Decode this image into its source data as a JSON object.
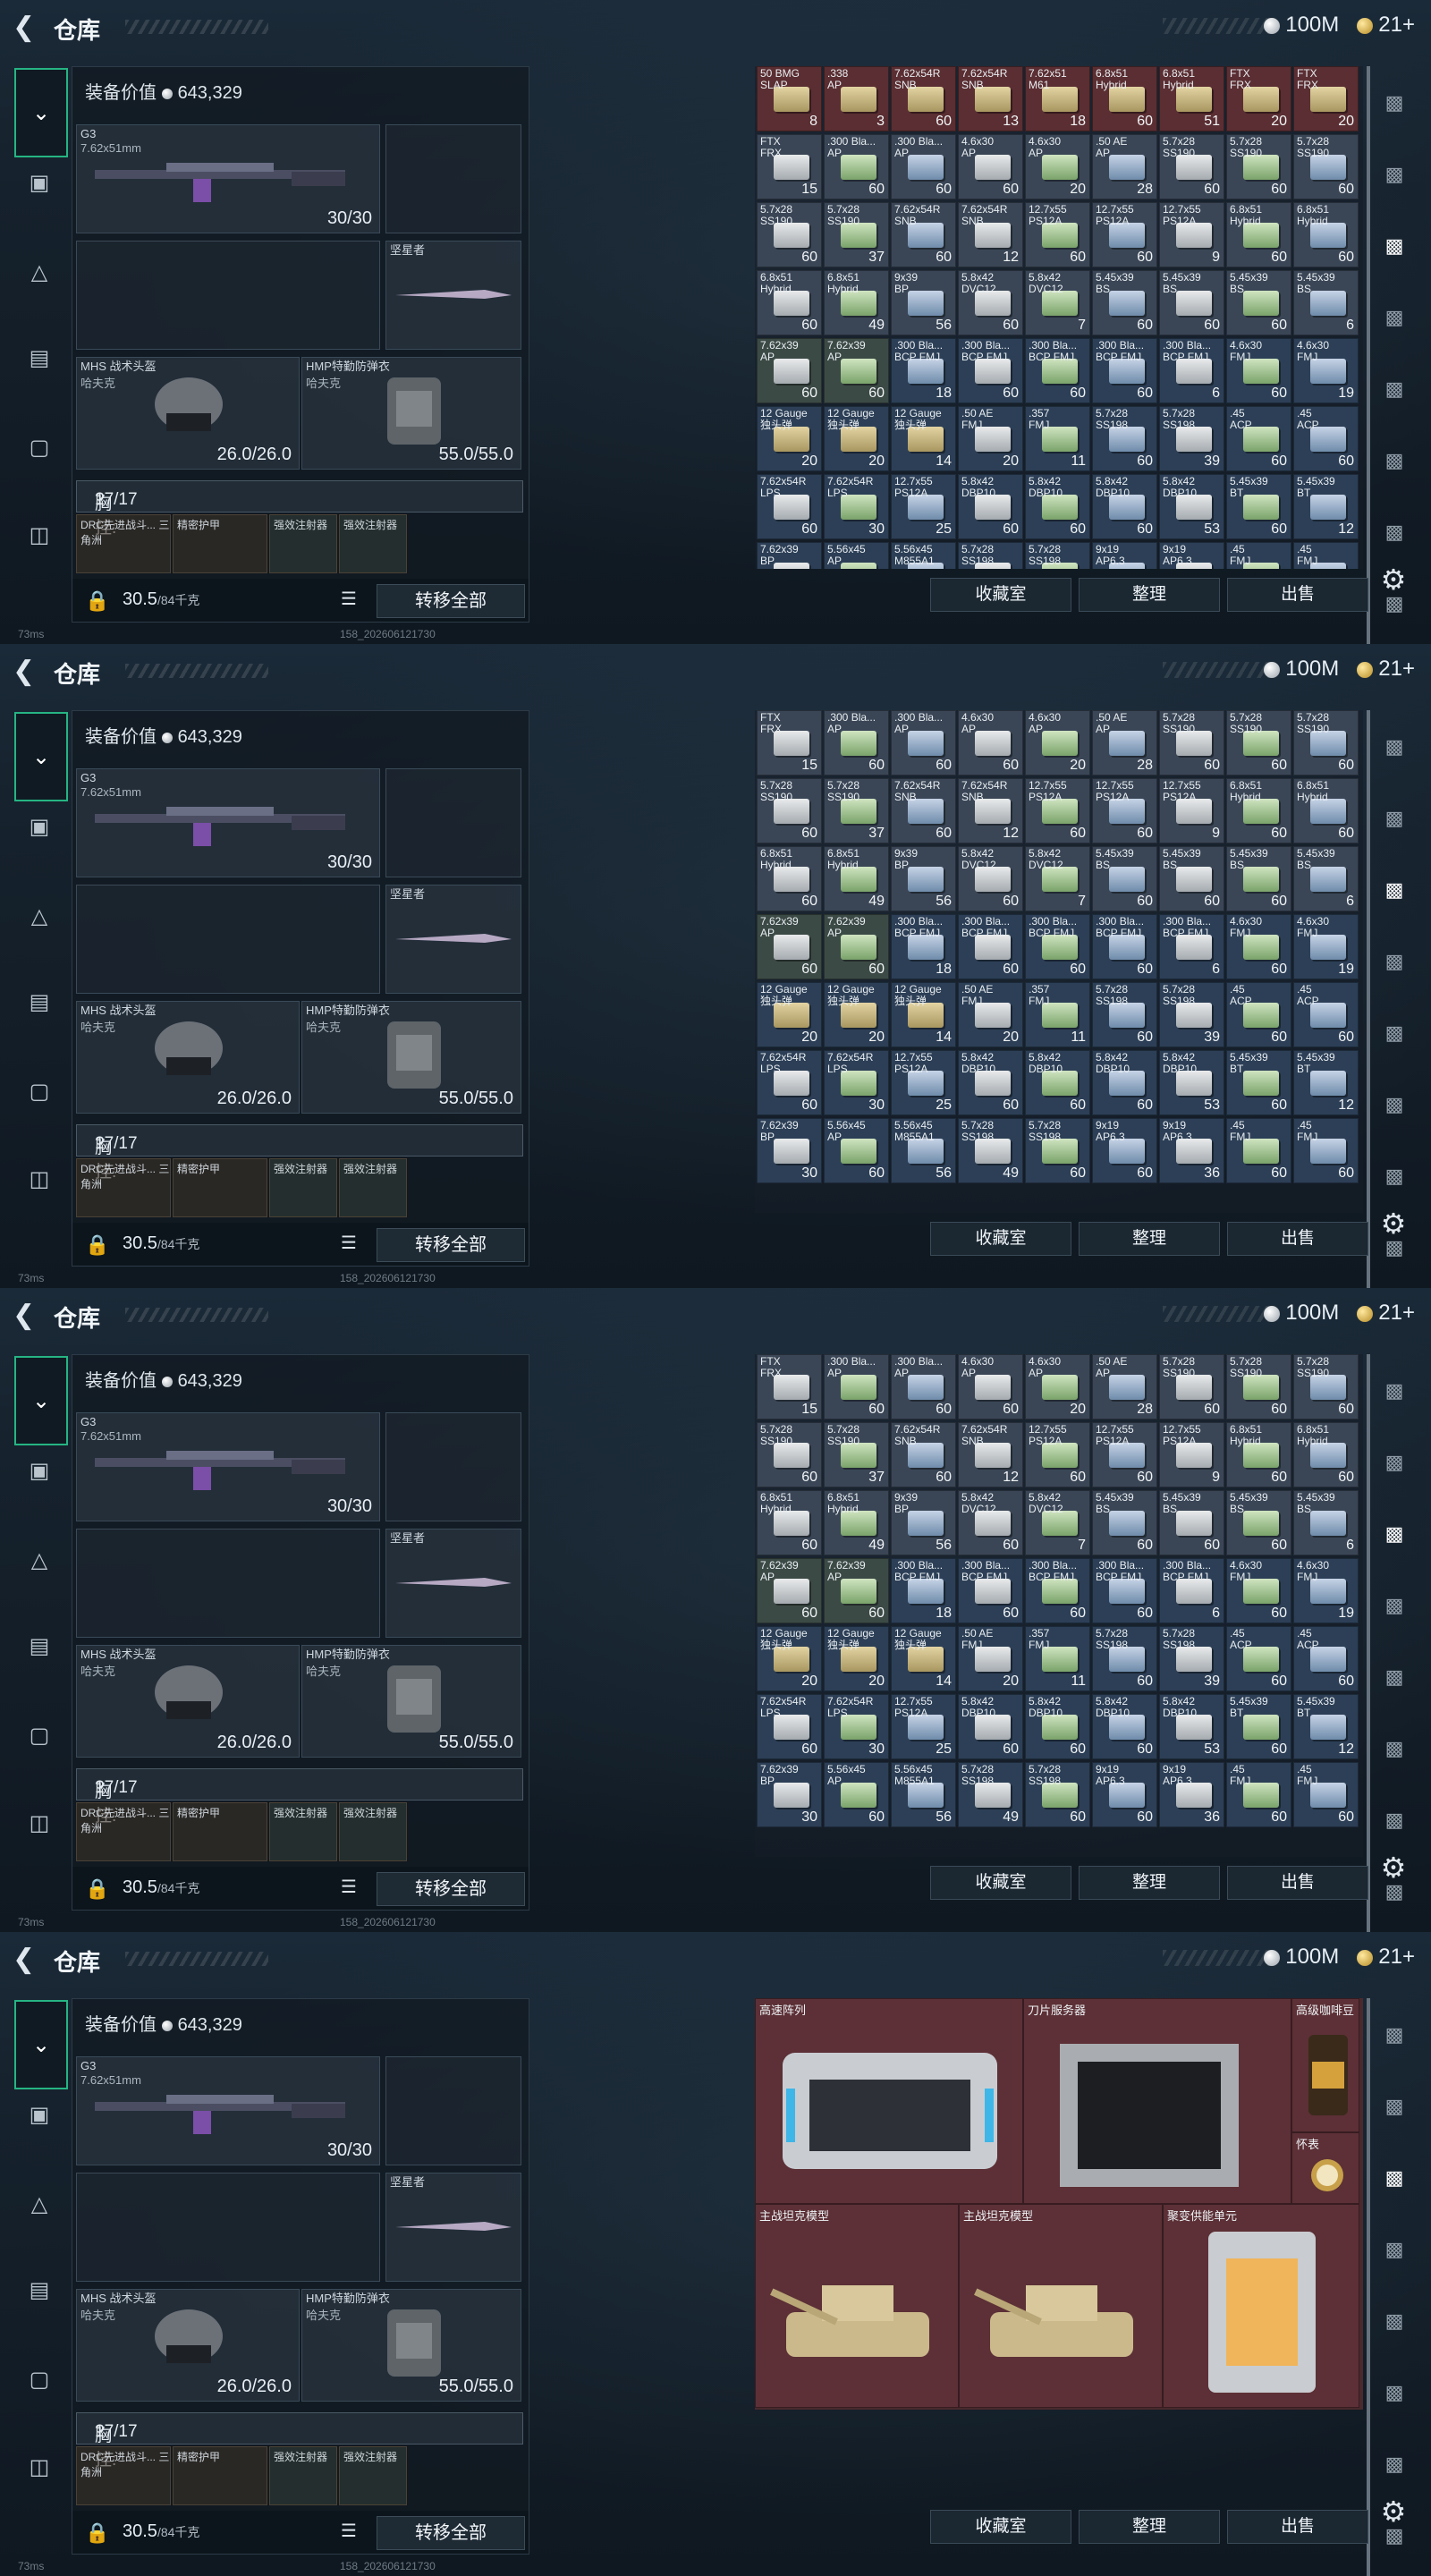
{
  "app": {
    "title": "仓库",
    "currency_silver": "100M",
    "currency_gold": "21+",
    "footer_ping": "73ms",
    "footer_id": "158_202606121730"
  },
  "equipment": {
    "value_label": "装备价值",
    "value": "643,329",
    "primary_weapon": {
      "name": "G3",
      "caliber": "7.62x51mm",
      "ammo": "30/30"
    },
    "melee": {
      "name": "坚星者"
    },
    "helmet": {
      "name": "MHS 战术头盔",
      "brand": "哈夫克",
      "durability": "26.0/26.0"
    },
    "armor": {
      "name": "HMP特勤防弹衣",
      "brand": "哈夫克",
      "durability": "55.0/55.0"
    },
    "chest_rig": {
      "label": "胸挂:",
      "capacity": "17/17",
      "help": "?"
    },
    "pouches": [
      "DRC先进战斗... 三角洲",
      "精密护甲",
      "强效注射器",
      "强效注射器"
    ],
    "weight": "30.5",
    "weight_limit": "/84千克",
    "transfer_all": "转移全部"
  },
  "actions": {
    "collection": "收藏室",
    "sort": "整理",
    "sell": "出售"
  },
  "colors": {
    "accent": "#26b483",
    "red_cell": "#5a2e32",
    "blue_cell": "#2c3f56",
    "slate_cell": "#3a4656"
  },
  "ammo_rows": [
    [
      {
        "n": "50 BMG\nSLAP",
        "q": "8",
        "c": "red"
      },
      {
        "n": ".338\nAP",
        "q": "3",
        "c": "red"
      },
      {
        "n": "7.62x54R\nSNB",
        "q": "60",
        "c": "red"
      },
      {
        "n": "7.62x54R\nSNB",
        "q": "13",
        "c": "red"
      },
      {
        "n": "7.62x51\nM61",
        "q": "18",
        "c": "red"
      },
      {
        "n": "6.8x51\nHybrid",
        "q": "60",
        "c": "red"
      },
      {
        "n": "6.8x51\nHybrid",
        "q": "51",
        "c": "red"
      },
      {
        "n": "FTX\nFRX",
        "q": "20",
        "c": "red"
      },
      {
        "n": "FTX\nFRX",
        "q": "20",
        "c": "red"
      }
    ],
    [
      {
        "n": "FTX\nFRX",
        "q": "15",
        "c": "slate"
      },
      {
        "n": ".300 Bla...\nAP",
        "q": "60",
        "c": "slate"
      },
      {
        "n": ".300 Bla...\nAP",
        "q": "60",
        "c": "slate"
      },
      {
        "n": "4.6x30\nAP",
        "q": "60",
        "c": "slate"
      },
      {
        "n": "4.6x30\nAP",
        "q": "20",
        "c": "slate"
      },
      {
        "n": ".50 AE\nAP",
        "q": "28",
        "c": "slate"
      },
      {
        "n": "5.7x28\nSS190",
        "q": "60",
        "c": "slate"
      },
      {
        "n": "5.7x28\nSS190",
        "q": "60",
        "c": "slate"
      },
      {
        "n": "5.7x28\nSS190",
        "q": "60",
        "c": "slate"
      }
    ],
    [
      {
        "n": "5.7x28\nSS190",
        "q": "60",
        "c": "slate"
      },
      {
        "n": "5.7x28\nSS190",
        "q": "37",
        "c": "slate"
      },
      {
        "n": "7.62x54R\nSNB",
        "q": "60",
        "c": "slate"
      },
      {
        "n": "7.62x54R\nSNB",
        "q": "12",
        "c": "slate"
      },
      {
        "n": "12.7x55\nPS12A",
        "q": "60",
        "c": "slate"
      },
      {
        "n": "12.7x55\nPS12A",
        "q": "60",
        "c": "slate"
      },
      {
        "n": "12.7x55\nPS12A",
        "q": "9",
        "c": "slate"
      },
      {
        "n": "6.8x51\nHybrid",
        "q": "60",
        "c": "slate"
      },
      {
        "n": "6.8x51\nHybrid",
        "q": "60",
        "c": "slate"
      }
    ],
    [
      {
        "n": "6.8x51\nHybrid",
        "q": "60",
        "c": "slate"
      },
      {
        "n": "6.8x51\nHybrid",
        "q": "49",
        "c": "slate"
      },
      {
        "n": "9x39\nBP",
        "q": "56",
        "c": "slate"
      },
      {
        "n": "5.8x42\nDVC12",
        "q": "60",
        "c": "slate"
      },
      {
        "n": "5.8x42\nDVC12",
        "q": "7",
        "c": "slate"
      },
      {
        "n": "5.45x39\nBS",
        "q": "60",
        "c": "slate"
      },
      {
        "n": "5.45x39\nBS",
        "q": "60",
        "c": "slate"
      },
      {
        "n": "5.45x39\nBS",
        "q": "60",
        "c": "slate"
      },
      {
        "n": "5.45x39\nBS",
        "q": "6",
        "c": "slate"
      }
    ],
    [
      {
        "n": "7.62x39\nAP",
        "q": "60",
        "c": "olive"
      },
      {
        "n": "7.62x39\nAP",
        "q": "60",
        "c": "olive"
      },
      {
        "n": ".300 Bla...\nBCP FMJ",
        "q": "18",
        "c": "blue"
      },
      {
        "n": ".300 Bla...\nBCP FMJ",
        "q": "60",
        "c": "blue"
      },
      {
        "n": ".300 Bla...\nBCP FMJ",
        "q": "60",
        "c": "blue"
      },
      {
        "n": ".300 Bla...\nBCP FMJ",
        "q": "60",
        "c": "blue"
      },
      {
        "n": ".300 Bla...\nBCP FMJ",
        "q": "6",
        "c": "blue"
      },
      {
        "n": "4.6x30\nFMJ",
        "q": "60",
        "c": "blue"
      },
      {
        "n": "4.6x30\nFMJ",
        "q": "19",
        "c": "blue"
      }
    ],
    [
      {
        "n": "12 Gauge\n独头弹",
        "q": "20",
        "c": "blue"
      },
      {
        "n": "12 Gauge\n独头弹",
        "q": "20",
        "c": "blue"
      },
      {
        "n": "12 Gauge\n独头弹",
        "q": "14",
        "c": "blue"
      },
      {
        "n": ".50 AE\nFMJ",
        "q": "20",
        "c": "blue"
      },
      {
        "n": ".357\nFMJ",
        "q": "11",
        "c": "blue"
      },
      {
        "n": "5.7x28\nSS198",
        "q": "60",
        "c": "blue"
      },
      {
        "n": "5.7x28\nSS198",
        "q": "39",
        "c": "blue"
      },
      {
        "n": ".45\nACP",
        "q": "60",
        "c": "blue"
      },
      {
        "n": ".45\nACP",
        "q": "60",
        "c": "blue"
      }
    ],
    [
      {
        "n": "7.62x54R\nLPS",
        "q": "60",
        "c": "blue"
      },
      {
        "n": "7.62x54R\nLPS",
        "q": "30",
        "c": "blue"
      },
      {
        "n": "12.7x55\nPS12A",
        "q": "25",
        "c": "blue"
      },
      {
        "n": "5.8x42\nDBP10",
        "q": "60",
        "c": "blue"
      },
      {
        "n": "5.8x42\nDBP10",
        "q": "60",
        "c": "blue"
      },
      {
        "n": "5.8x42\nDBP10",
        "q": "60",
        "c": "blue"
      },
      {
        "n": "5.8x42\nDBP10",
        "q": "53",
        "c": "blue"
      },
      {
        "n": "5.45x39\nBT",
        "q": "60",
        "c": "blue"
      },
      {
        "n": "5.45x39\nBT",
        "q": "12",
        "c": "blue"
      }
    ],
    [
      {
        "n": "7.62x39\nBP",
        "q": "30",
        "c": "blue"
      },
      {
        "n": "5.56x45\nAP",
        "q": "60",
        "c": "blue"
      },
      {
        "n": "5.56x45\nM855A1",
        "q": "56",
        "c": "blue"
      },
      {
        "n": "5.7x28\nSS198",
        "q": "49",
        "c": "blue"
      },
      {
        "n": "5.7x28\nSS198",
        "q": "60",
        "c": "blue"
      },
      {
        "n": "9x19\nAP6.3",
        "q": "60",
        "c": "blue"
      },
      {
        "n": "9x19\nAP6.3",
        "q": "36",
        "c": "blue"
      },
      {
        "n": ".45\nFMJ",
        "q": "60",
        "c": "blue"
      },
      {
        "n": ".45\nFMJ",
        "q": "60",
        "c": "blue"
      }
    ]
  ],
  "valuables": [
    {
      "name": "高速阵列"
    },
    {
      "name": "刀片服务器"
    },
    {
      "name": "高级咖啡豆"
    },
    {
      "name": "怀表"
    },
    {
      "name": "主战坦克模型"
    },
    {
      "name": "主战坦克模型"
    },
    {
      "name": "聚变供能单元"
    }
  ]
}
